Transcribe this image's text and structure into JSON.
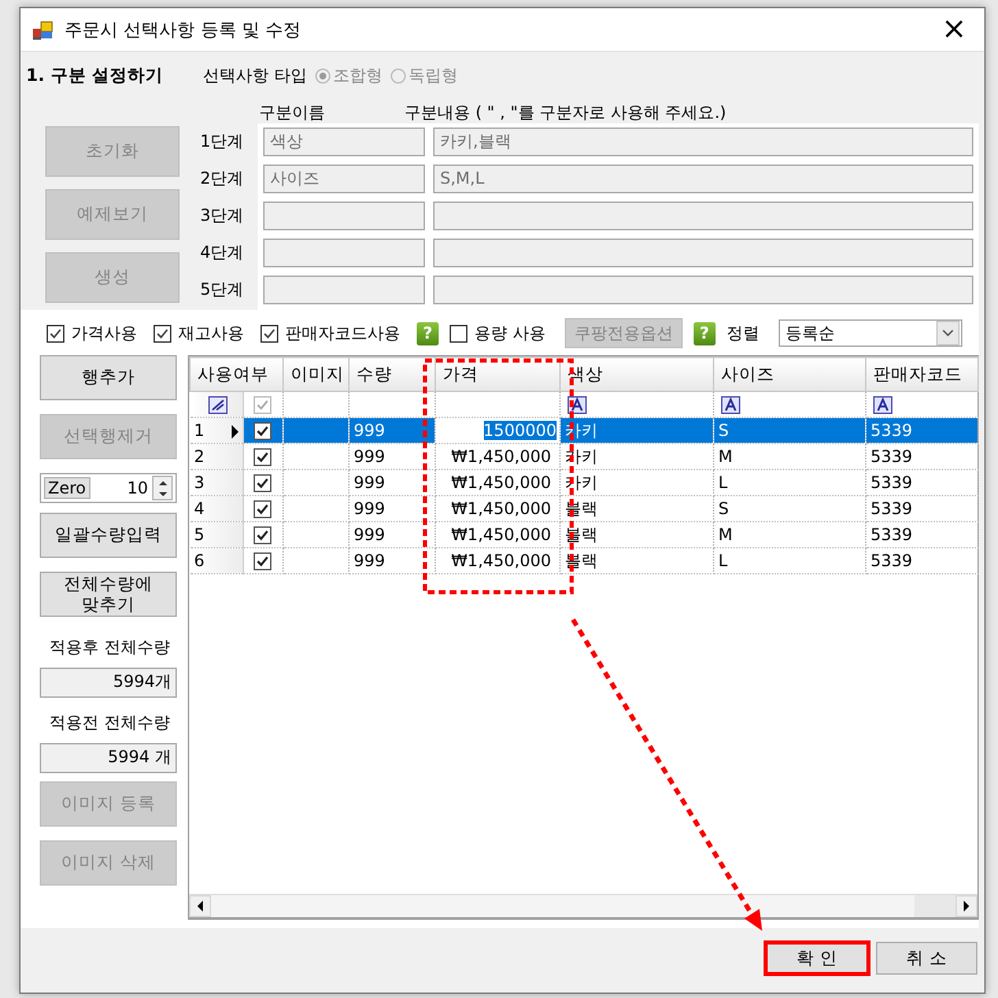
{
  "window": {
    "title": "주문시 선택사항 등록 및 수정",
    "close": "×"
  },
  "section": {
    "title": "1. 구분 설정하기",
    "type_label": "선택사항 타입",
    "type_options": [
      {
        "label": "조합형",
        "selected": true,
        "disabled": true
      },
      {
        "label": "독립형",
        "selected": false,
        "disabled": true
      }
    ]
  },
  "stage_headers": [
    "구분이름",
    "구분내용 ( \" , \"를 구분자로 사용해 주세요.)"
  ],
  "setup_buttons": [
    {
      "label": "초기화",
      "disabled": true
    },
    {
      "label": "예제보기",
      "disabled": true
    },
    {
      "label": "생성",
      "disabled": true
    }
  ],
  "stages": [
    {
      "label": "1단계",
      "name": "색상",
      "content": "카키,블랙"
    },
    {
      "label": "2단계",
      "name": "사이즈",
      "content": "S,M,L"
    },
    {
      "label": "3단계"
    },
    {
      "label": "4단계"
    },
    {
      "label": "5단계"
    }
  ],
  "toolbar": [
    {
      "kind": "checkbox",
      "label": "가격사용",
      "checked": true
    },
    {
      "kind": "checkbox",
      "label": "재고사용",
      "checked": true
    },
    {
      "kind": "checkbox",
      "label": "판매자코드사용",
      "checked": true
    },
    {
      "kind": "help",
      "text": "?"
    },
    {
      "kind": "checkbox",
      "label": "용량 사용",
      "checked": false
    },
    {
      "kind": "button",
      "label": "쿠팡전용옵션",
      "disabled": true
    },
    {
      "kind": "help",
      "text": "?"
    },
    {
      "kind": "label",
      "label": "정렬"
    },
    {
      "kind": "dropdown",
      "value": "등록순"
    }
  ],
  "side_panel": [
    {
      "kind": "button",
      "label": "행추가",
      "disabled": false
    },
    {
      "kind": "button",
      "label": "선택행제거",
      "disabled": true
    },
    {
      "kind": "spinner",
      "label": "Zero",
      "value": "10"
    },
    {
      "kind": "button",
      "label": "일괄수량입력",
      "disabled": false
    },
    {
      "kind": "button",
      "label": "전체수량에 맞추기",
      "disabled": false
    },
    {
      "kind": "caption",
      "label": "적용후 전체수량"
    },
    {
      "kind": "readout",
      "value": "5994개"
    },
    {
      "kind": "caption",
      "label": "적용전 전체수량"
    },
    {
      "kind": "readout",
      "value": "5994 개"
    },
    {
      "kind": "button",
      "label": "이미지 등록",
      "disabled": true
    },
    {
      "kind": "button",
      "label": "이미지 삭제",
      "disabled": true
    }
  ],
  "grid": {
    "columns": [
      {
        "label": "사용여부",
        "kind": "check"
      },
      {
        "label": "이미지",
        "kind": "equals"
      },
      {
        "label": "수량",
        "kind": "equals"
      },
      {
        "label": "가격",
        "kind": "equals"
      },
      {
        "label": "색상",
        "kind": "text"
      },
      {
        "label": "사이즈",
        "kind": "text"
      },
      {
        "label": "판매자코드",
        "kind": "text"
      }
    ],
    "rows": [
      {
        "number": "1",
        "selected": true,
        "current": true,
        "used": true,
        "quantity": "999",
        "price": "1500000",
        "price_editing": true,
        "color_option": "카키",
        "size": "S",
        "code": "5339"
      },
      {
        "number": "2",
        "selected": false,
        "current": false,
        "used": true,
        "quantity": "999",
        "price": "₩1,450,000",
        "price_editing": false,
        "color_option": "카키",
        "size": "M",
        "code": "5339"
      },
      {
        "number": "3",
        "selected": false,
        "current": false,
        "used": true,
        "quantity": "999",
        "price": "₩1,450,000",
        "price_editing": false,
        "color_option": "카키",
        "size": "L",
        "code": "5339"
      },
      {
        "number": "4",
        "selected": false,
        "current": false,
        "used": true,
        "quantity": "999",
        "price": "₩1,450,000",
        "price_editing": false,
        "color_option": "블랙",
        "size": "S",
        "code": "5339"
      },
      {
        "number": "5",
        "selected": false,
        "current": false,
        "used": true,
        "quantity": "999",
        "price": "₩1,450,000",
        "price_editing": false,
        "color_option": "블랙",
        "size": "M",
        "code": "5339"
      },
      {
        "number": "6",
        "selected": false,
        "current": false,
        "used": true,
        "quantity": "999",
        "price": "₩1,450,000",
        "price_editing": false,
        "color_option": "블랙",
        "size": "L",
        "code": "5339"
      }
    ]
  },
  "dialog_buttons": [
    {
      "label": "확 인",
      "annotated": true
    },
    {
      "label": "취 소",
      "annotated": false
    }
  ]
}
